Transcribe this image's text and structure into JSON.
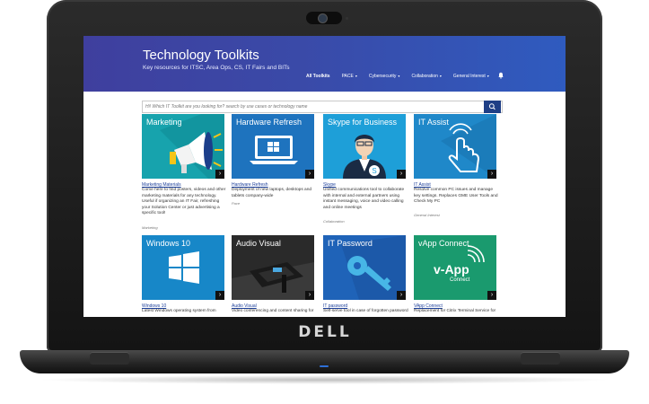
{
  "header": {
    "title": "Technology Toolkits",
    "subtitle": "Key resources for ITSC, Area Ops, CS, IT Fairs and BITs"
  },
  "nav": {
    "items": [
      {
        "label": "All Toolkits"
      },
      {
        "label": "PACE"
      },
      {
        "label": "Cybersecurity"
      },
      {
        "label": "Collaboration"
      },
      {
        "label": "General Interest"
      }
    ]
  },
  "search": {
    "placeholder": "Hi! Which IT Toolkit are you looking for? search by use cases or technology name"
  },
  "brand": {
    "logo": "DELL"
  },
  "colors": {
    "hero_start": "#3f3f9e",
    "hero_end": "#2f5bbf",
    "link": "#1c3f9a",
    "search_button": "#1f3f86"
  },
  "cards": [
    {
      "tile_label": "Marketing",
      "link": "Marketing Materials",
      "description": "Come here to find posters, videos and other marketing materials for any technology. Useful if organizing an IT Fair, refreshing your Solution Center or just advertising a specific tool!",
      "tag": "Marketing",
      "icon": "megaphone-icon"
    },
    {
      "tile_label": "Hardware Refresh",
      "link": "Hardware Refresh",
      "description": "Deployment of new laptops, desktops and tablets company-wide",
      "tag": "Pace",
      "icon": "laptop-icon"
    },
    {
      "tile_label": "Skype for Business",
      "link": "Skype",
      "description": "Unified communications tool to collaborate with internal and external partners using instant messaging, voice and video calling and online meetings",
      "tag": "Collaboration",
      "icon": "skype-user-icon"
    },
    {
      "tile_label": "IT Assist",
      "link": "IT Assist",
      "description": "Resolve common PC issues and manage key settings. Replaces GME User Tools and Check My PC",
      "tag": "General Interest",
      "icon": "touch-hand-icon"
    },
    {
      "tile_label": "Windows 10",
      "link": "Windows 10",
      "description": "Latest Windows operating system from",
      "tag": "",
      "icon": "windows-logo-icon"
    },
    {
      "tile_label": "Audio Visual",
      "link": "Audio Visual",
      "description": "Video conferencing and content sharing for",
      "tag": "",
      "icon": "conference-phone-icon"
    },
    {
      "tile_label": "IT Password",
      "link": "IT password",
      "description": "Self-serve tool in case of forgotten password",
      "tag": "",
      "icon": "key-icon"
    },
    {
      "tile_label": "vApp Connect",
      "link": "VApp Connect",
      "description": "Replacement for Citrix Terminal Service for",
      "tag": "",
      "icon": "vapp-connect-icon",
      "logo_text": "v-App",
      "logo_sub": "Connect"
    }
  ]
}
